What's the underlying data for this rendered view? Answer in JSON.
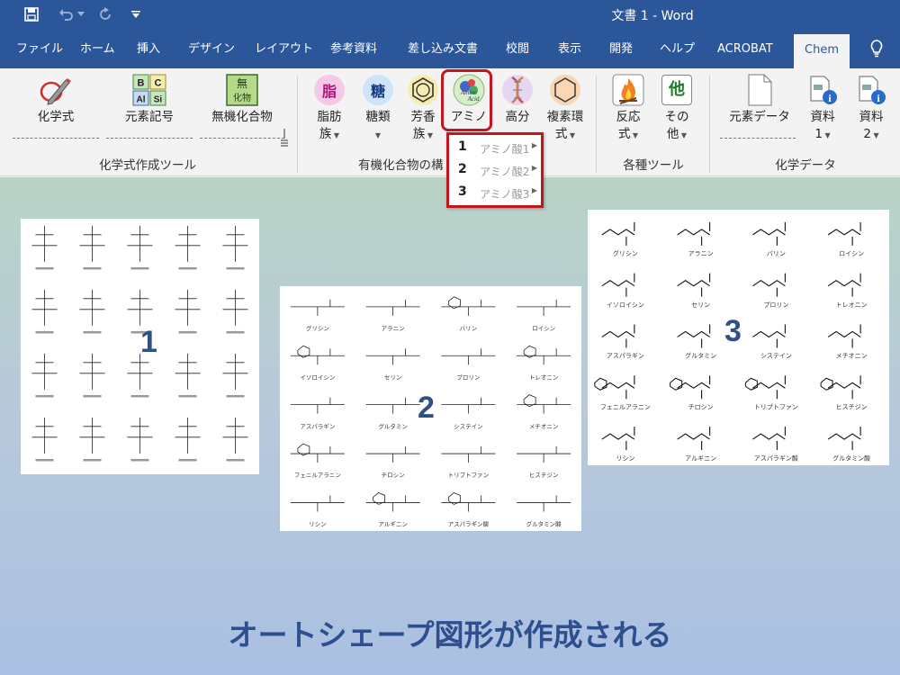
{
  "window": {
    "title": "文書 1  -  Word"
  },
  "tabs": [
    "ファイル",
    "ホーム",
    "挿入",
    "デザイン",
    "レイアウト",
    "参考資料",
    "差し込み文書",
    "校閲",
    "表示",
    "開発",
    "ヘルプ",
    "ACROBAT",
    "Chem"
  ],
  "active_tab": "Chem",
  "ribbon": {
    "formula_group": {
      "label": "化学式作成ツール",
      "buttons": {
        "formula": "化学式",
        "element": "元素記号",
        "inorganic": "無機化合物"
      },
      "element_tiles": [
        "B",
        "C",
        "Al",
        "Si"
      ],
      "inorganic_icon_text": [
        "無",
        "化物"
      ]
    },
    "organic_group": {
      "label": "有機化合物の構",
      "buttons": {
        "fat": [
          "脂肪",
          "族"
        ],
        "sugar": [
          "糖類",
          ""
        ],
        "aromatic": [
          "芳香",
          "族"
        ],
        "amino": [
          "アミノ",
          ""
        ],
        "polymer": [
          "高分",
          ""
        ],
        "hetero": [
          "複素環",
          "式"
        ]
      },
      "fat_icon": "脂",
      "sugar_icon": "糖",
      "amino_icon_text": [
        "Amino",
        "Acid"
      ]
    },
    "tools_group": {
      "label": "各種ツール",
      "buttons": {
        "reaction": [
          "反応",
          "式"
        ],
        "other": [
          "その",
          "他"
        ]
      },
      "other_icon": "他"
    },
    "data_group": {
      "label": "化学データ",
      "buttons": {
        "element_data": "元素データ",
        "ref1": [
          "資料",
          "1"
        ],
        "ref2": [
          "資料",
          "2"
        ]
      }
    }
  },
  "amino_menu": [
    {
      "num": "1",
      "label": "アミノ酸1"
    },
    {
      "num": "2",
      "label": "アミノ酸2"
    },
    {
      "num": "3",
      "label": "アミノ酸3"
    }
  ],
  "panels": {
    "p1": {
      "num": "1"
    },
    "p2": {
      "num": "2",
      "names": [
        "グリシン",
        "アラニン",
        "バリン",
        "ロイシン",
        "イソロイシン",
        "セリン",
        "プロリン",
        "トレオニン",
        "アスパラギン",
        "グルタミン",
        "システイン",
        "メチオニン",
        "フェニルアラニン",
        "チロシン",
        "トリプトファン",
        "ヒスチジン",
        "リシン",
        "アルギニン",
        "アスパラギン酸",
        "グルタミン酸"
      ]
    },
    "p3": {
      "num": "3",
      "names": [
        "グリシン",
        "アラニン",
        "バリン",
        "ロイシン",
        "イソロイシン",
        "セリン",
        "プロリン",
        "トレオニン",
        "アスパラギン",
        "グルタミン",
        "システイン",
        "メチオニン",
        "フェニルアラニン",
        "チロシン",
        "トリプトファン",
        "ヒスチジン",
        "リシン",
        "アルギニン",
        "アスパラギン酸",
        "グルタミン酸"
      ]
    }
  },
  "caption": "オートシェープ図形が作成される"
}
